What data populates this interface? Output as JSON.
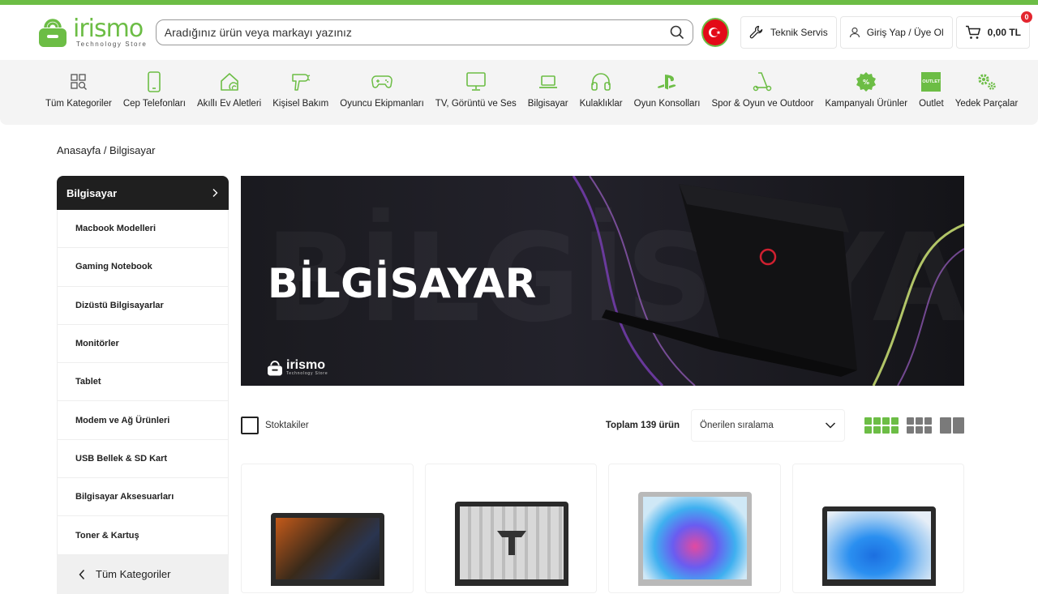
{
  "header": {
    "logo_word": "irismo",
    "logo_sub": "Technology Store",
    "search_placeholder": "Aradığınız ürün veya markayı yazınız",
    "technical_service": "Teknik Servis",
    "login": "Giriş Yap / Üye Ol",
    "cart_total": "0,00 TL",
    "cart_count": "0"
  },
  "categories": [
    {
      "label": "Tüm Kategoriler",
      "icon": "grid-search-icon"
    },
    {
      "label": "Cep Telefonları",
      "icon": "phone-icon"
    },
    {
      "label": "Akıllı Ev Aletleri",
      "icon": "smart-home-icon"
    },
    {
      "label": "Kişisel Bakım",
      "icon": "hair-dryer-icon"
    },
    {
      "label": "Oyuncu Ekipmanları",
      "icon": "gamepad-icon"
    },
    {
      "label": "TV, Görüntü ve Ses",
      "icon": "tv-icon"
    },
    {
      "label": "Bilgisayar",
      "icon": "laptop-icon"
    },
    {
      "label": "Kulaklıklar",
      "icon": "headphones-icon"
    },
    {
      "label": "Oyun Konsolları",
      "icon": "playstation-icon"
    },
    {
      "label": "Spor & Oyun ve Outdoor",
      "icon": "scooter-icon"
    },
    {
      "label": "Kampanyalı Ürünler",
      "icon": "discount-badge-icon"
    },
    {
      "label": "Outlet",
      "icon": "outlet-icon",
      "badge": "OUTLET"
    },
    {
      "label": "Yedek Parçalar",
      "icon": "gears-icon"
    }
  ],
  "breadcrumb": "Anasayfa / Bilgisayar",
  "sidebar": {
    "title": "Bilgisayar",
    "items": [
      "Macbook Modelleri",
      "Gaming Notebook",
      "Dizüstü Bilgisayarlar",
      "Monitörler",
      "Tablet",
      "Modem ve Ağ Ürünleri",
      "USB Bellek & SD Kart",
      "Bilgisayar Aksesuarları",
      "Toner & Kartuş"
    ],
    "all_categories": "Tüm Kategoriler"
  },
  "banner": {
    "title": "BİLGİSAYAR",
    "ghost": "BİLGİSAYAR",
    "logo_word": "irismo",
    "logo_sub": "Technology Store"
  },
  "toolbar": {
    "in_stock": "Stoktakiler",
    "total": "Toplam 139 ürün",
    "sort_selected": "Önerilen sıralama"
  },
  "colors": {
    "brand_green": "#6cbd45",
    "dark": "#1f1f1f",
    "badge_red": "#e3262f"
  }
}
